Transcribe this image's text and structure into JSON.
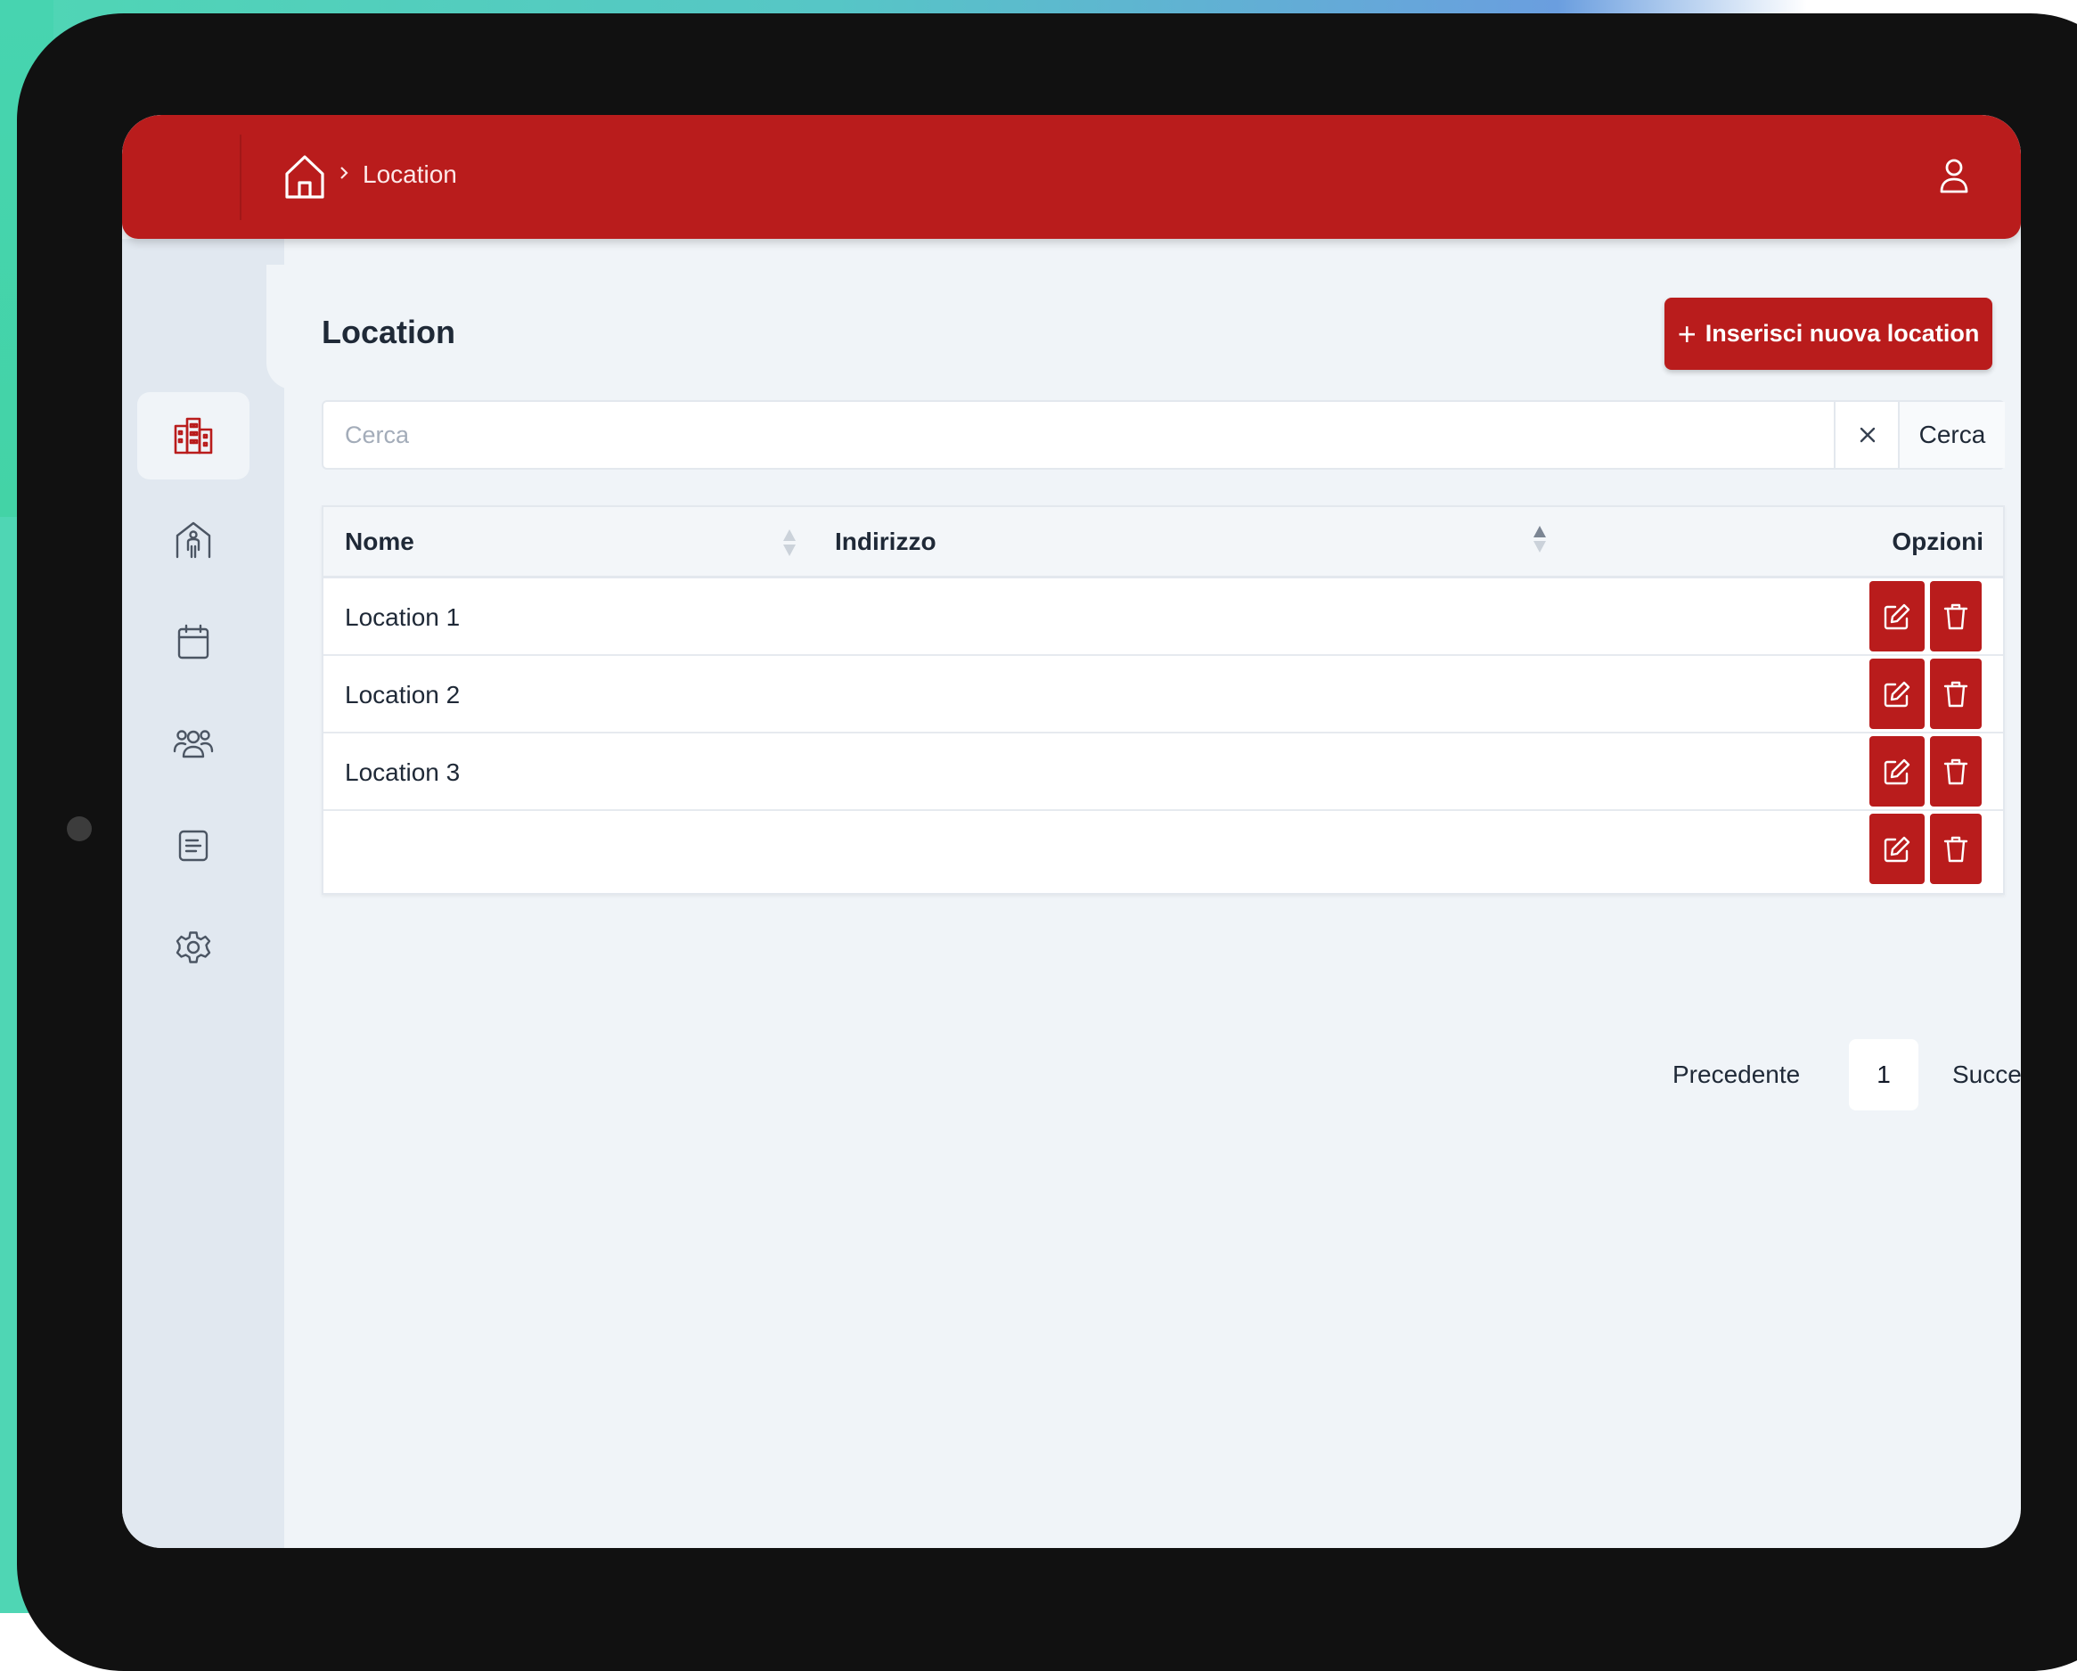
{
  "colors": {
    "brand": "#b91c1c",
    "screen_background": "#f0f4f8",
    "sidebar_background": "#e1e8f0",
    "icon_gray": "#4b5563"
  },
  "header": {
    "home_icon": "home-icon",
    "breadcrumb_current": "Location",
    "user_icon": "user-icon"
  },
  "sidebar": {
    "items": [
      {
        "icon": "buildings-icon",
        "active": true
      },
      {
        "icon": "person-house-icon",
        "active": false
      },
      {
        "icon": "calendar-icon",
        "active": false
      },
      {
        "icon": "users-icon",
        "active": false
      },
      {
        "icon": "document-icon",
        "active": false
      },
      {
        "icon": "gear-icon",
        "active": false
      }
    ]
  },
  "main": {
    "title": "Location",
    "add_button": {
      "icon": "plus-icon",
      "label": "Inserisci nuova location"
    },
    "search": {
      "placeholder": "Cerca",
      "value": "",
      "clear_icon": "close-icon",
      "button_label": "Cerca"
    }
  },
  "table": {
    "columns": [
      "Nome",
      "Indirizzo",
      "Opzioni"
    ],
    "rows": [
      {
        "nome": "Location 1",
        "indirizzo": ""
      },
      {
        "nome": "Location 2",
        "indirizzo": ""
      },
      {
        "nome": "Location 3",
        "indirizzo": ""
      },
      {
        "nome": "",
        "indirizzo": ""
      }
    ],
    "row_actions": [
      "edit-icon",
      "trash-icon"
    ]
  },
  "pagination": {
    "previous_label": "Precedente",
    "current_page": "1",
    "next_label": "Successivo"
  }
}
